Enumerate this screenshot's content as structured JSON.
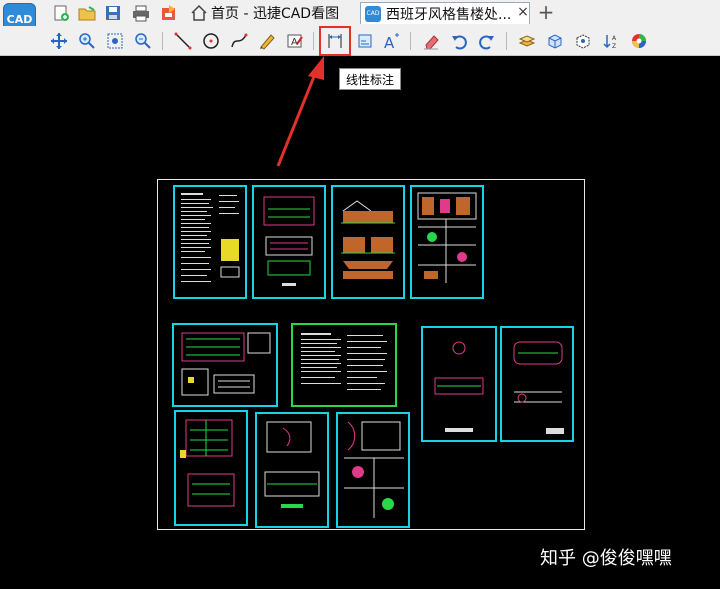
{
  "app": {
    "logo_text": "CAD"
  },
  "tabs": {
    "home_label": "首页 - 迅捷CAD看图",
    "doc_label": "西班牙风格售楼处...",
    "doc_icon_text": "CAD",
    "close_glyph": "×",
    "add_glyph": "+"
  },
  "tooltip": {
    "text": "线性标注"
  },
  "watermark": {
    "text": "知乎 @俊俊嘿嘿"
  },
  "colors": {
    "sheet_border": "#14d4e6",
    "highlight": "#e0322b",
    "accent": "#2f8ad8"
  }
}
